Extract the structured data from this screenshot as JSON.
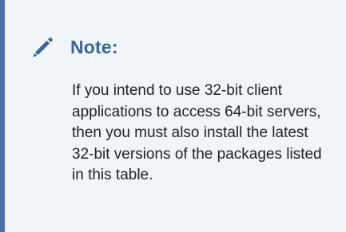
{
  "note": {
    "icon": "pencil-icon",
    "title": "Note:",
    "body": "If you intend to use 32-bit client applications to access 64-bit servers, then you must also install the latest 32-bit versions of the packages listed in this table.",
    "colors": {
      "accent_bar": "#4a6fa5",
      "title": "#3a6596",
      "icon": "#3a6596",
      "background": "#f0f5fa",
      "text": "#222222"
    }
  }
}
